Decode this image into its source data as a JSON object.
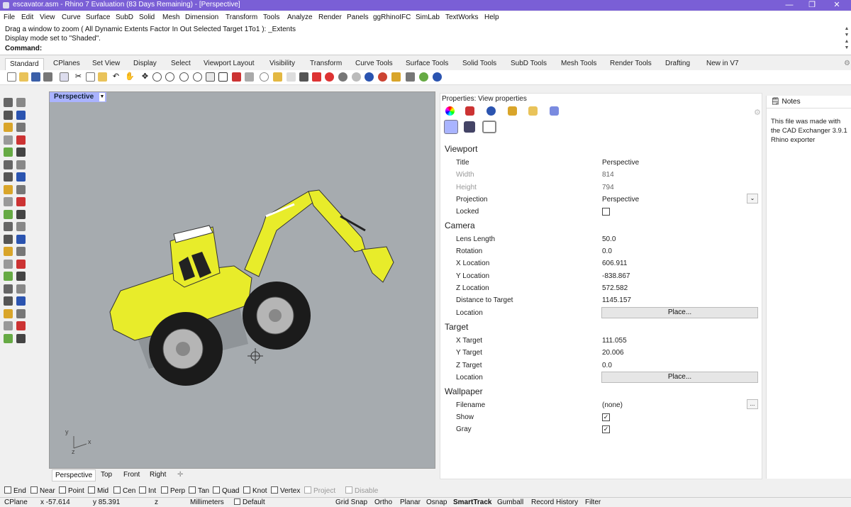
{
  "window": {
    "title": "escavator.asm - Rhino 7 Evaluation (83 Days Remaining) - [Perspective]",
    "minimize": "—",
    "maximize": "❐",
    "close": "✕"
  },
  "menu": [
    "File",
    "Edit",
    "View",
    "Curve",
    "Surface",
    "SubD",
    "Solid",
    "Mesh",
    "Dimension",
    "Transform",
    "Tools",
    "Analyze",
    "Render",
    "Panels",
    "ggRhinoIFC",
    "SimLab",
    "TextWorks",
    "Help"
  ],
  "command": {
    "history1": "Drag a window to zoom ( All  Dynamic  Extents  Factor  In  Out  Selected  Target  1To1 ): _Extents",
    "history2": "Display mode set to \"Shaded\".",
    "prompt": "Command:",
    "value": ""
  },
  "toolbar_tabs": [
    "Standard",
    "CPlanes",
    "Set View",
    "Display",
    "Select",
    "Viewport Layout",
    "Visibility",
    "Transform",
    "Curve Tools",
    "Surface Tools",
    "Solid Tools",
    "SubD Tools",
    "Mesh Tools",
    "Render Tools",
    "Drafting",
    "New in V7"
  ],
  "viewport": {
    "name": "Perspective",
    "axes": {
      "y": "y",
      "x": "x",
      "z": "z"
    }
  },
  "view_tabs": [
    "Perspective",
    "Top",
    "Front",
    "Right"
  ],
  "properties": {
    "title": "Properties: View properties",
    "sections": {
      "viewport": "Viewport",
      "camera": "Camera",
      "target": "Target",
      "wallpaper": "Wallpaper"
    },
    "viewport": {
      "title_label": "Title",
      "title_value": "Perspective",
      "width_label": "Width",
      "width_value": "814",
      "height_label": "Height",
      "height_value": "794",
      "projection_label": "Projection",
      "projection_value": "Perspective",
      "locked_label": "Locked"
    },
    "camera": {
      "lens_label": "Lens Length",
      "lens_value": "50.0",
      "rotation_label": "Rotation",
      "rotation_value": "0.0",
      "xloc_label": "X Location",
      "xloc_value": "606.911",
      "yloc_label": "Y Location",
      "yloc_value": "-838.867",
      "zloc_label": "Z Location",
      "zloc_value": "572.582",
      "dist_label": "Distance to Target",
      "dist_value": "1145.157",
      "location_label": "Location",
      "place_button": "Place..."
    },
    "target": {
      "xt_label": "X Target",
      "xt_value": "111.055",
      "yt_label": "Y Target",
      "yt_value": "20.006",
      "zt_label": "Z Target",
      "zt_value": "0.0",
      "location_label": "Location",
      "place_button": "Place..."
    },
    "wallpaper": {
      "filename_label": "Filename",
      "filename_value": "(none)",
      "browse_button": "...",
      "show_label": "Show",
      "gray_label": "Gray"
    }
  },
  "notes": {
    "title": "Notes",
    "text": "This file was made with the CAD Exchanger 3.9.1 Rhino exporter"
  },
  "osnaps": [
    "End",
    "Near",
    "Point",
    "Mid",
    "Cen",
    "Int",
    "Perp",
    "Tan",
    "Quad",
    "Knot",
    "Vertex",
    "Project",
    "Disable"
  ],
  "status": {
    "cplane": "CPlane",
    "x": "x -57.614",
    "y": "y 85.391",
    "z": "z",
    "units": "Millimeters",
    "layer": "Default",
    "grid_snap": "Grid Snap",
    "ortho": "Ortho",
    "planar": "Planar",
    "osnap": "Osnap",
    "smarttrack": "SmartTrack",
    "gumball": "Gumball",
    "record_history": "Record History",
    "filter": "Filter"
  },
  "colors": {
    "titlebar": "#7a5fd6",
    "viewport_bg": "#a6abaf",
    "model_yellow": "#e8ec2a",
    "vp_tab": "#aab3ff"
  }
}
